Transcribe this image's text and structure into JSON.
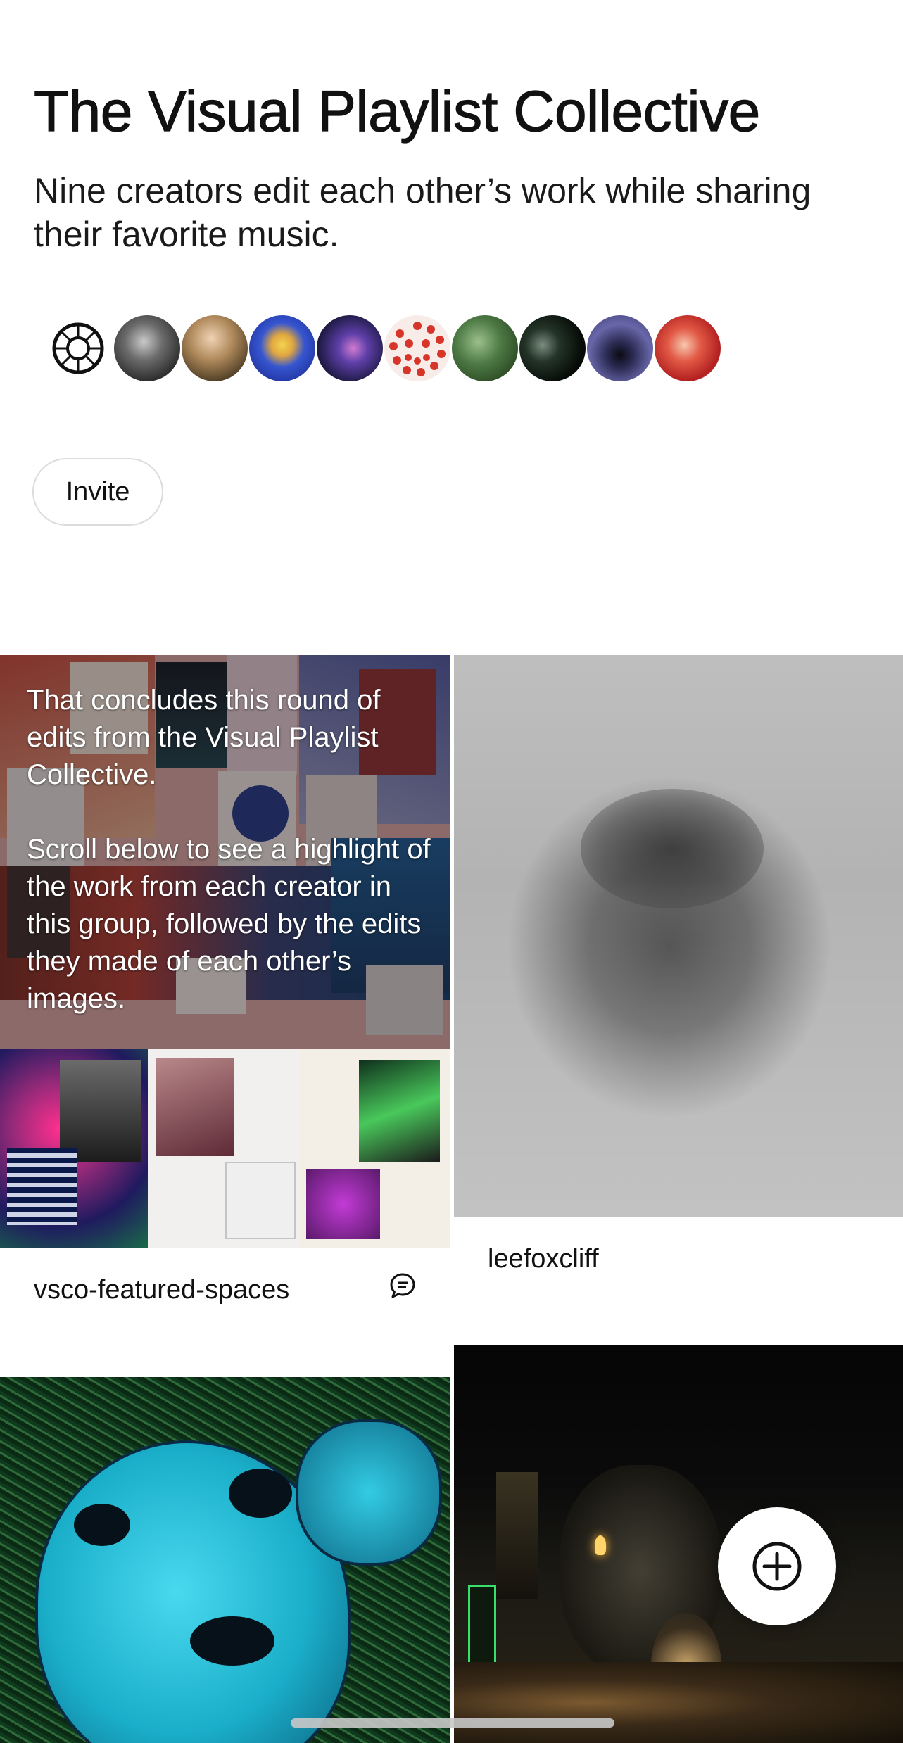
{
  "header": {
    "title": "The Visual Playlist Collective",
    "subtitle": "Nine creators edit each other’s work while sharing their favorite music."
  },
  "members": [
    {
      "icon": "vsco-logo-icon",
      "bg": "#ffffff"
    },
    {
      "icon": "member-avatar-1",
      "bg": "#5c5c5c"
    },
    {
      "icon": "member-avatar-2",
      "bg": "#a08a5a"
    },
    {
      "icon": "member-avatar-3",
      "bg": "#2e4fc4"
    },
    {
      "icon": "member-avatar-4",
      "bg": "#1b1840"
    },
    {
      "icon": "member-avatar-5",
      "bg": "#f2e4de"
    },
    {
      "icon": "member-avatar-6",
      "bg": "#3f6a3a"
    },
    {
      "icon": "member-avatar-7",
      "bg": "#0d140f"
    },
    {
      "icon": "member-avatar-8",
      "bg": "#4d4c86"
    },
    {
      "icon": "member-avatar-9",
      "bg": "#d23a30"
    }
  ],
  "actions": {
    "invite_label": "Invite"
  },
  "feed": {
    "tiles": [
      {
        "overlay_lines_1": "That concludes this round of edits from the Visual Playlist Collective.",
        "overlay_lines_2": "Scroll below to see a highlight of the work from each creator in this group, followed by the edits they made of each other’s images.",
        "caption": "vsco-featured-spaces",
        "icon": "comment-icon"
      },
      {
        "caption": "leefoxcliff"
      }
    ]
  },
  "fab": {
    "icon": "add-circle-icon"
  },
  "colors": {
    "accent": "#111111",
    "background": "#ffffff",
    "tile_divider": "#ffffff"
  }
}
